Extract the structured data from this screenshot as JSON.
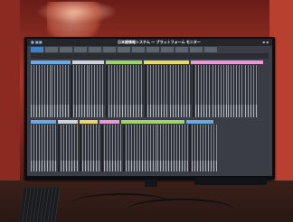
{
  "scene": {
    "colors": {
      "wall": "#a23a2b",
      "screen_bg": "#3a3d44",
      "tab_active": "#3d83c8"
    },
    "screen": {
      "title": "日本語情報システム ～ プラットフォーム モニター",
      "tabs": [
        "",
        "",
        "",
        "",
        "",
        "",
        "",
        "",
        "",
        "",
        "",
        "",
        ""
      ]
    }
  }
}
